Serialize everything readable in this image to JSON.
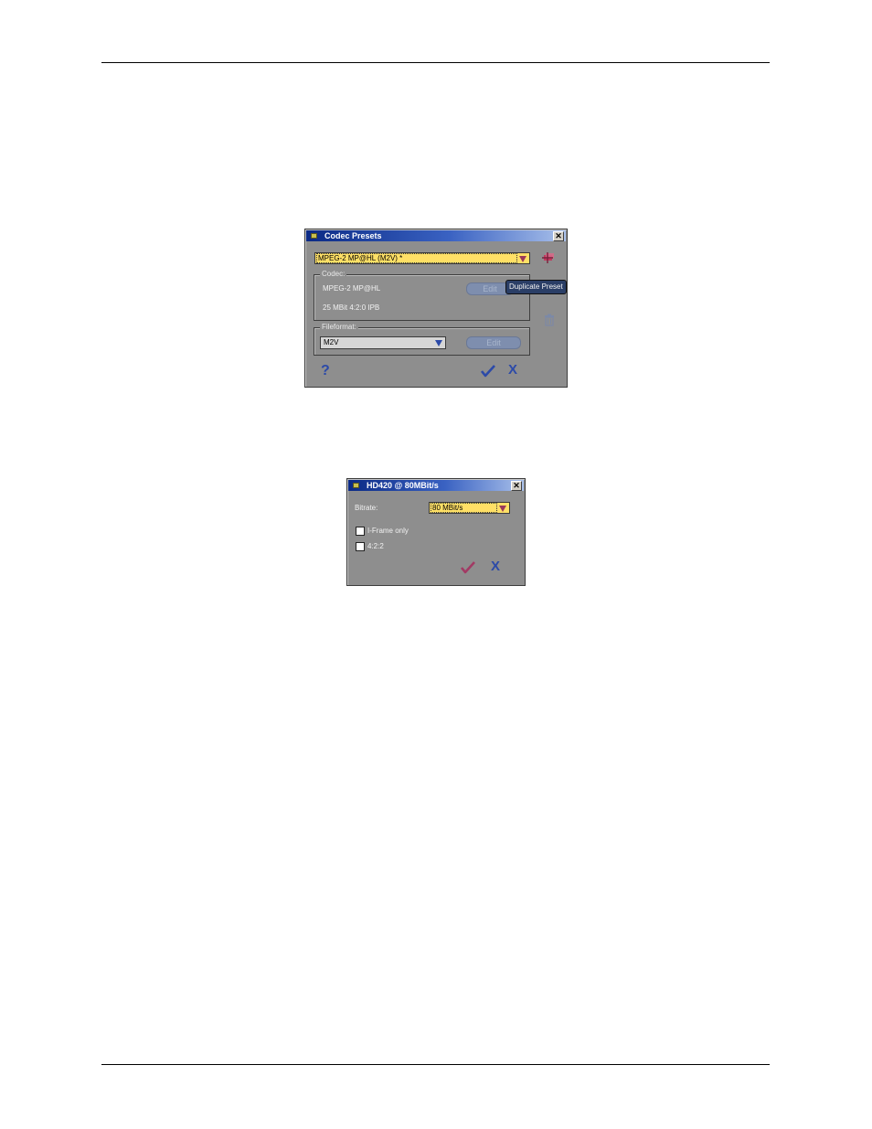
{
  "codec_presets_dialog": {
    "title": "Codec Presets",
    "close_glyph": "✕",
    "preset_value": "MPEG-2 MP@HL (M2V) *",
    "codec_group": {
      "label": "Codec:",
      "name": "MPEG-2 MP@HL",
      "details": "25 MBit 4:2:0 IPB",
      "edit_label": "Edit"
    },
    "tooltip": "Duplicate Preset",
    "fileformat_group": {
      "label": "Fileformat:",
      "value": "M2V",
      "edit_label": "Edit"
    },
    "icons": {
      "duplicate": "duplicate-preset-icon",
      "delete": "trash-icon",
      "help": "help-icon",
      "ok": "checkmark-icon",
      "cancel": "cancel-x-icon"
    },
    "help_glyph": "?",
    "cancel_glyph": "X"
  },
  "hd420_dialog": {
    "title": "HD420 @ 80MBit/s",
    "close_glyph": "✕",
    "bitrate_label": "Bitrate:",
    "bitrate_value": "80 MBit/s",
    "iframe_label": "I-Frame only",
    "iframe_checked": false,
    "chroma_label": "4:2:2",
    "chroma_checked": false,
    "cancel_glyph": "X"
  },
  "colors": {
    "dialog_bg": "#8e8e8e",
    "title_gradient_start": "#0b2a85",
    "combo_highlight": "#ffe066",
    "accent_red": "#9a3a5a",
    "accent_blue": "#2c4aa8"
  }
}
